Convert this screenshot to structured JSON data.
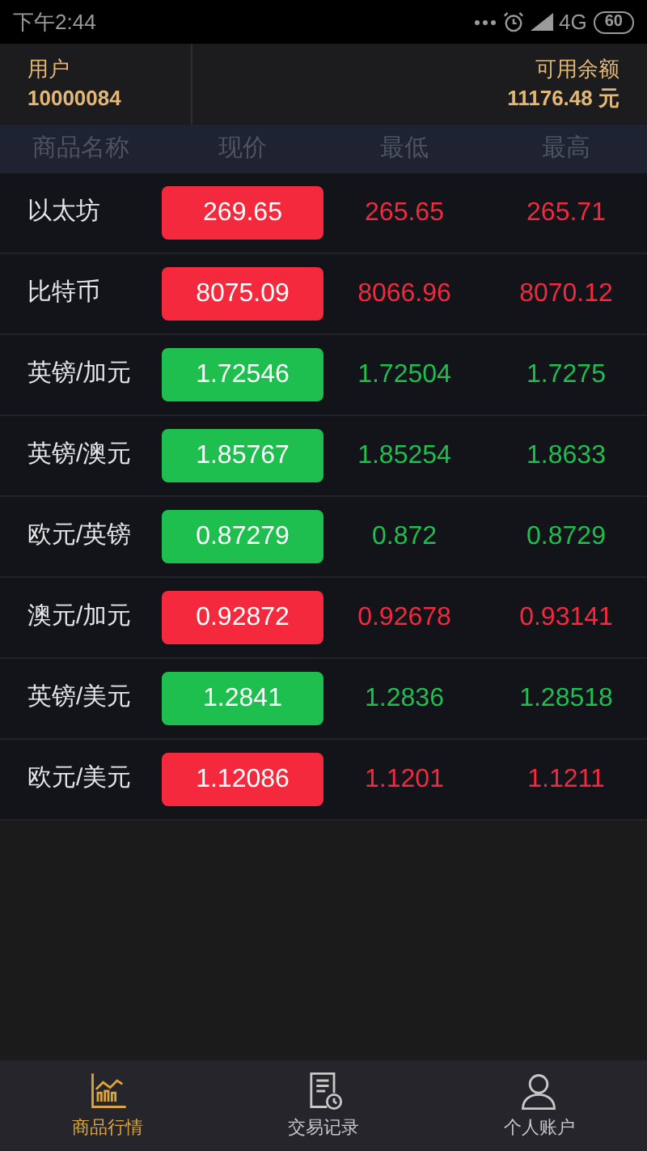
{
  "status_bar": {
    "time": "下午2:44",
    "network": "4G",
    "battery": "60"
  },
  "account": {
    "user_label": "用户",
    "user_id": "10000084",
    "balance_label": "可用余额",
    "balance": "11176.48 元"
  },
  "table": {
    "columns": [
      "商品名称",
      "现价",
      "最低",
      "最高"
    ],
    "rows": [
      {
        "name": "以太坊",
        "price": "269.65",
        "low": "265.65",
        "high": "265.71",
        "color": "#f5293d"
      },
      {
        "name": "比特币",
        "price": "8075.09",
        "low": "8066.96",
        "high": "8070.12",
        "color": "#f5293d"
      },
      {
        "name": "英镑/加元",
        "price": "1.72546",
        "low": "1.72504",
        "high": "1.7275",
        "color": "#1fbf4f"
      },
      {
        "name": "英镑/澳元",
        "price": "1.85767",
        "low": "1.85254",
        "high": "1.8633",
        "color": "#1fbf4f"
      },
      {
        "name": "欧元/英镑",
        "price": "0.87279",
        "low": "0.872",
        "high": "0.8729",
        "color": "#1fbf4f"
      },
      {
        "name": "澳元/加元",
        "price": "0.92872",
        "low": "0.92678",
        "high": "0.93141",
        "color": "#f5293d"
      },
      {
        "name": "英镑/美元",
        "price": "1.2841",
        "low": "1.2836",
        "high": "1.28518",
        "color": "#1fbf4f"
      },
      {
        "name": "欧元/美元",
        "price": "1.12086",
        "low": "1.1201",
        "high": "1.1211",
        "color": "#f5293d"
      }
    ]
  },
  "tab_bar": [
    {
      "label": "商品行情",
      "kind": "chart",
      "selected": true
    },
    {
      "label": "交易记录",
      "kind": "record",
      "selected": false
    },
    {
      "label": "个人账户",
      "kind": "person",
      "selected": false
    }
  ]
}
